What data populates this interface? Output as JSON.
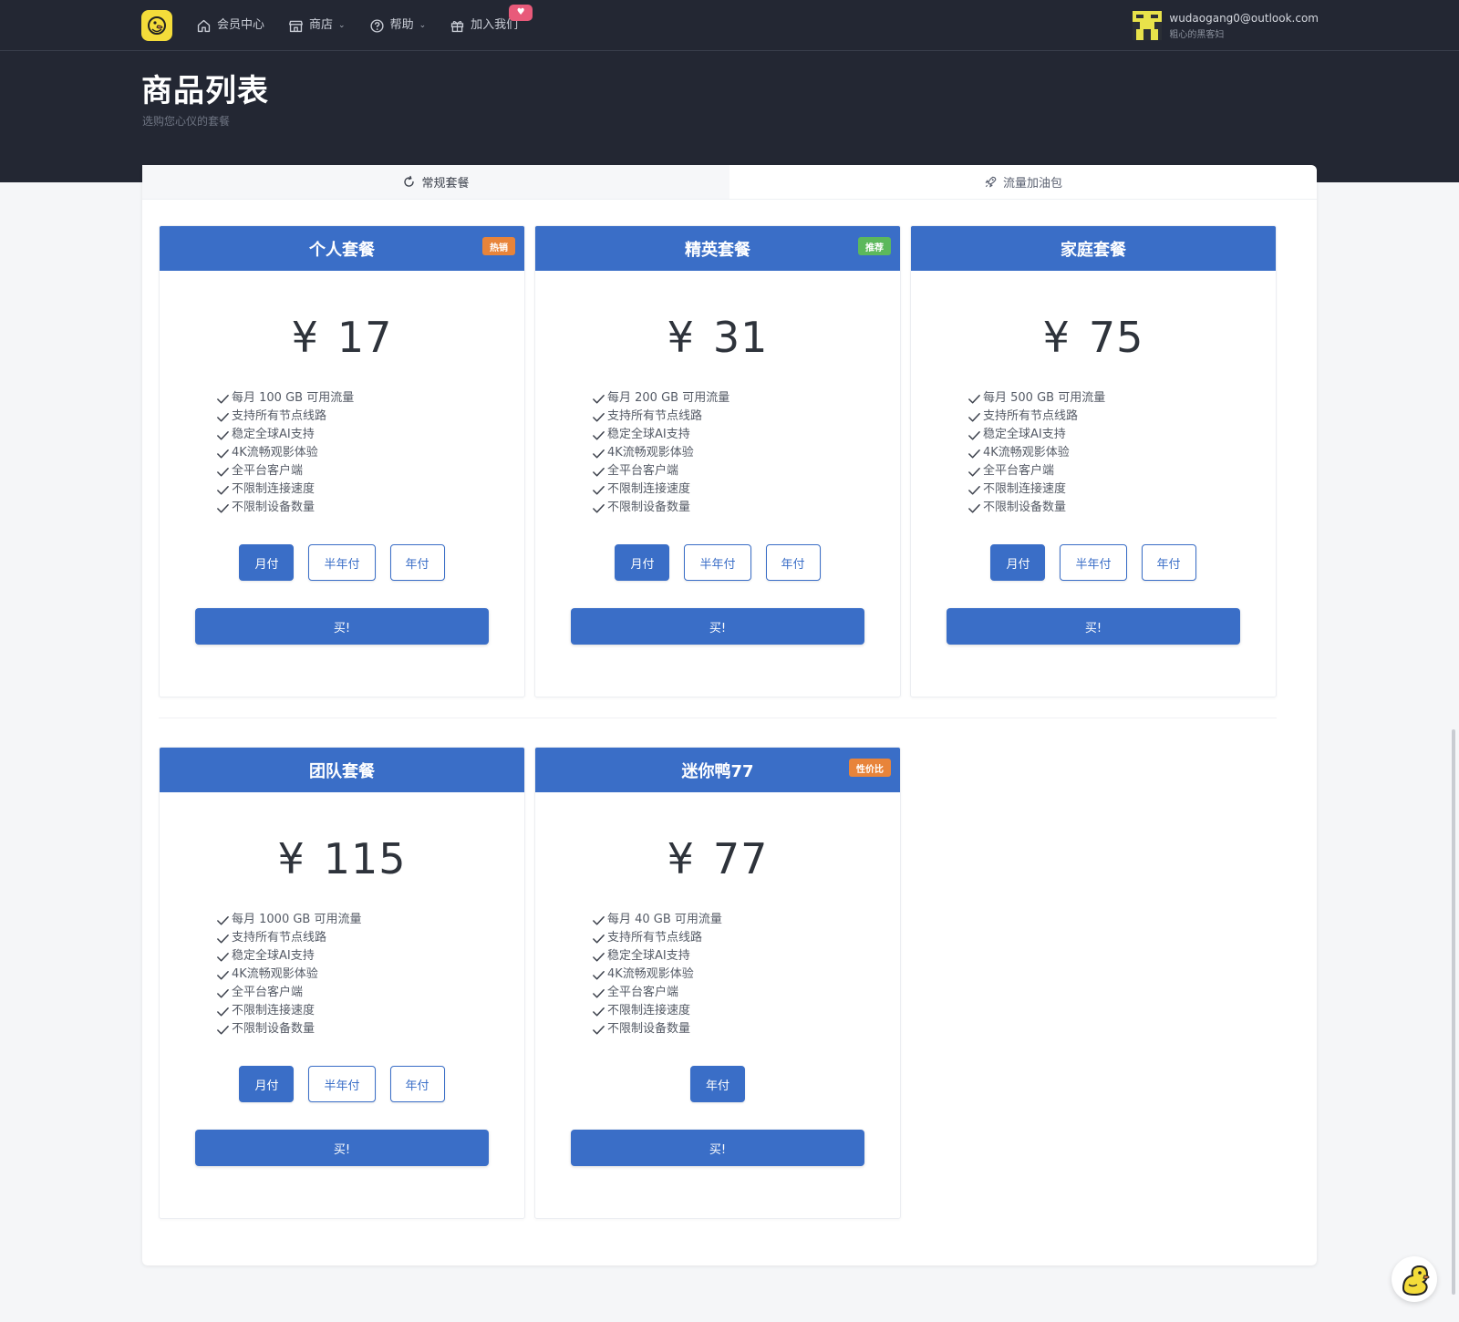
{
  "nav": {
    "items": [
      {
        "label": "会员中心",
        "icon": "home-icon",
        "caret": false
      },
      {
        "label": "商店",
        "icon": "store-icon",
        "caret": true
      },
      {
        "label": "帮助",
        "icon": "help-icon",
        "caret": true
      },
      {
        "label": "加入我们",
        "icon": "gift-icon",
        "caret": false
      }
    ]
  },
  "user": {
    "email": "wudaogang0@outlook.com",
    "subtitle": "粗心的黑客妇"
  },
  "page": {
    "title": "商品列表",
    "subtitle": "选购您心仪的套餐"
  },
  "tabs": [
    {
      "label": "常规套餐",
      "icon": "refresh-icon",
      "active": true
    },
    {
      "label": "流量加油包",
      "icon": "rocket-icon",
      "active": false
    }
  ],
  "plans": [
    {
      "name": "个人套餐",
      "tag": "热销",
      "tag_color": "#e8843a",
      "currency": "¥",
      "price": "17",
      "features": [
        "每月 100 GB 可用流量",
        "支持所有节点线路",
        "稳定全球AI支持",
        "4K流畅观影体验",
        "全平台客户端",
        "不限制连接速度",
        "不限制设备数量"
      ],
      "periods": [
        {
          "label": "月付",
          "active": true
        },
        {
          "label": "半年付",
          "active": false
        },
        {
          "label": "年付",
          "active": false
        }
      ],
      "buy_label": "买!"
    },
    {
      "name": "精英套餐",
      "tag": "推荐",
      "tag_color": "#5cb85c",
      "currency": "¥",
      "price": "31",
      "features": [
        "每月 200 GB 可用流量",
        "支持所有节点线路",
        "稳定全球AI支持",
        "4K流畅观影体验",
        "全平台客户端",
        "不限制连接速度",
        "不限制设备数量"
      ],
      "periods": [
        {
          "label": "月付",
          "active": true
        },
        {
          "label": "半年付",
          "active": false
        },
        {
          "label": "年付",
          "active": false
        }
      ],
      "buy_label": "买!"
    },
    {
      "name": "家庭套餐",
      "tag": "",
      "tag_color": "",
      "currency": "¥",
      "price": "75",
      "features": [
        "每月 500 GB 可用流量",
        "支持所有节点线路",
        "稳定全球AI支持",
        "4K流畅观影体验",
        "全平台客户端",
        "不限制连接速度",
        "不限制设备数量"
      ],
      "periods": [
        {
          "label": "月付",
          "active": true
        },
        {
          "label": "半年付",
          "active": false
        },
        {
          "label": "年付",
          "active": false
        }
      ],
      "buy_label": "买!"
    },
    {
      "name": "团队套餐",
      "tag": "",
      "tag_color": "",
      "currency": "¥",
      "price": "115",
      "features": [
        "每月 1000 GB 可用流量",
        "支持所有节点线路",
        "稳定全球AI支持",
        "4K流畅观影体验",
        "全平台客户端",
        "不限制连接速度",
        "不限制设备数量"
      ],
      "periods": [
        {
          "label": "月付",
          "active": true
        },
        {
          "label": "半年付",
          "active": false
        },
        {
          "label": "年付",
          "active": false
        }
      ],
      "buy_label": "买!"
    },
    {
      "name": "迷你鸭77",
      "tag": "性价比",
      "tag_color": "#e8843a",
      "currency": "¥",
      "price": "77",
      "features": [
        "每月 40 GB 可用流量",
        "支持所有节点线路",
        "稳定全球AI支持",
        "4K流畅观影体验",
        "全平台客户端",
        "不限制连接速度",
        "不限制设备数量"
      ],
      "periods": [
        {
          "label": "年付",
          "active": true
        }
      ],
      "buy_label": "买!"
    }
  ],
  "colors": {
    "accent": "#3a6ec7",
    "header_bg": "#232733",
    "logo_yellow": "#f4dc3a"
  }
}
